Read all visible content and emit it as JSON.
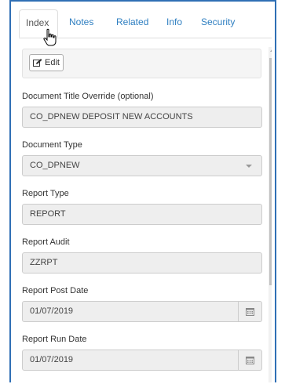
{
  "tabs": [
    {
      "label": "Index"
    },
    {
      "label": "Notes"
    },
    {
      "label": "Related"
    },
    {
      "label": "Info"
    },
    {
      "label": "Security"
    }
  ],
  "toolbar": {
    "edit_label": "Edit"
  },
  "fields": {
    "title_override": {
      "label": "Document Title Override (optional)",
      "value": "CO_DPNEW DEPOSIT NEW ACCOUNTS"
    },
    "document_type": {
      "label": "Document Type",
      "value": "CO_DPNEW"
    },
    "report_type": {
      "label": "Report Type",
      "value": "REPORT"
    },
    "report_audit": {
      "label": "Report Audit",
      "value": "ZZRPT"
    },
    "report_post_date": {
      "label": "Report Post Date",
      "value": "01/07/2019"
    },
    "report_run_date": {
      "label": "Report Run Date",
      "value": "01/07/2019"
    }
  },
  "colors": {
    "accent": "#2f7fc1",
    "frame_border": "#2f6fb5",
    "input_bg": "#eeeeee"
  }
}
